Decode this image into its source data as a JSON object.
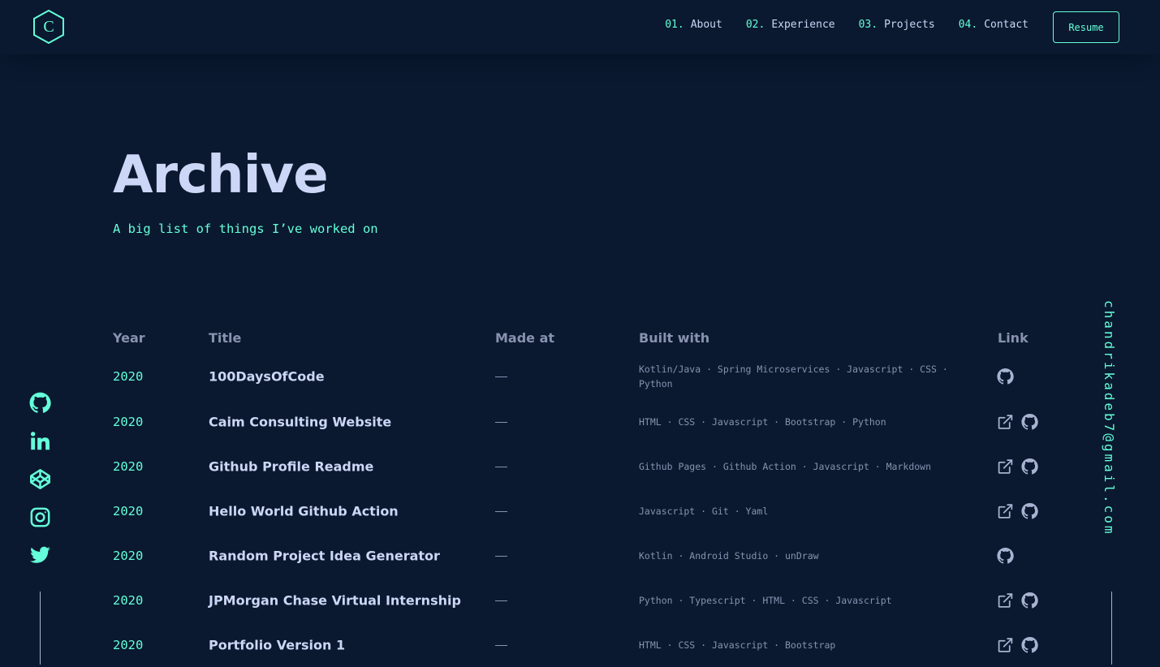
{
  "nav": {
    "logo_letter": "C",
    "links": [
      {
        "num": "01.",
        "label": "About"
      },
      {
        "num": "02.",
        "label": "Experience"
      },
      {
        "num": "03.",
        "label": "Projects"
      },
      {
        "num": "04.",
        "label": "Contact"
      }
    ],
    "resume_label": "Resume"
  },
  "hero": {
    "title": "Archive",
    "subtitle": "A big list of things I’ve worked on"
  },
  "table": {
    "headers": {
      "year": "Year",
      "title": "Title",
      "made_at": "Made at",
      "built_with": "Built with",
      "link": "Link"
    },
    "rows": [
      {
        "year": "2020",
        "title": "100DaysOfCode",
        "made_at": "—",
        "tech": "Kotlin/Java · Spring Microservices · Javascript · CSS · Python",
        "links": [
          "github-icon"
        ]
      },
      {
        "year": "2020",
        "title": "Caim Consulting Website",
        "made_at": "—",
        "tech": "HTML · CSS · Javascript · Bootstrap · Python",
        "links": [
          "external-link-icon",
          "github-icon"
        ]
      },
      {
        "year": "2020",
        "title": "Github Profile Readme",
        "made_at": "—",
        "tech": "Github Pages · Github Action · Javascript · Markdown",
        "links": [
          "external-link-icon",
          "github-icon"
        ]
      },
      {
        "year": "2020",
        "title": "Hello World Github Action",
        "made_at": "—",
        "tech": "Javascript · Git · Yaml",
        "links": [
          "external-link-icon",
          "github-icon"
        ]
      },
      {
        "year": "2020",
        "title": "Random Project Idea Generator",
        "made_at": "—",
        "tech": "Kotlin · Android Studio · unDraw",
        "links": [
          "github-icon"
        ]
      },
      {
        "year": "2020",
        "title": "JPMorgan Chase Virtual Internship",
        "made_at": "—",
        "tech": "Python · Typescript · HTML · CSS · Javascript",
        "links": [
          "external-link-icon",
          "github-icon"
        ]
      },
      {
        "year": "2020",
        "title": "Portfolio Version 1",
        "made_at": "—",
        "tech": "HTML · CSS · Javascript · Bootstrap",
        "links": [
          "external-link-icon",
          "github-icon"
        ]
      }
    ]
  },
  "social": [
    "github-icon",
    "linkedin-icon",
    "codepen-icon",
    "instagram-icon",
    "twitter-icon"
  ],
  "email": "chandrikadeb7@gmail.com",
  "colors": {
    "background": "#0a192f",
    "accent": "#64ffda",
    "heading": "#ccd6f6",
    "muted": "#8892b0"
  }
}
